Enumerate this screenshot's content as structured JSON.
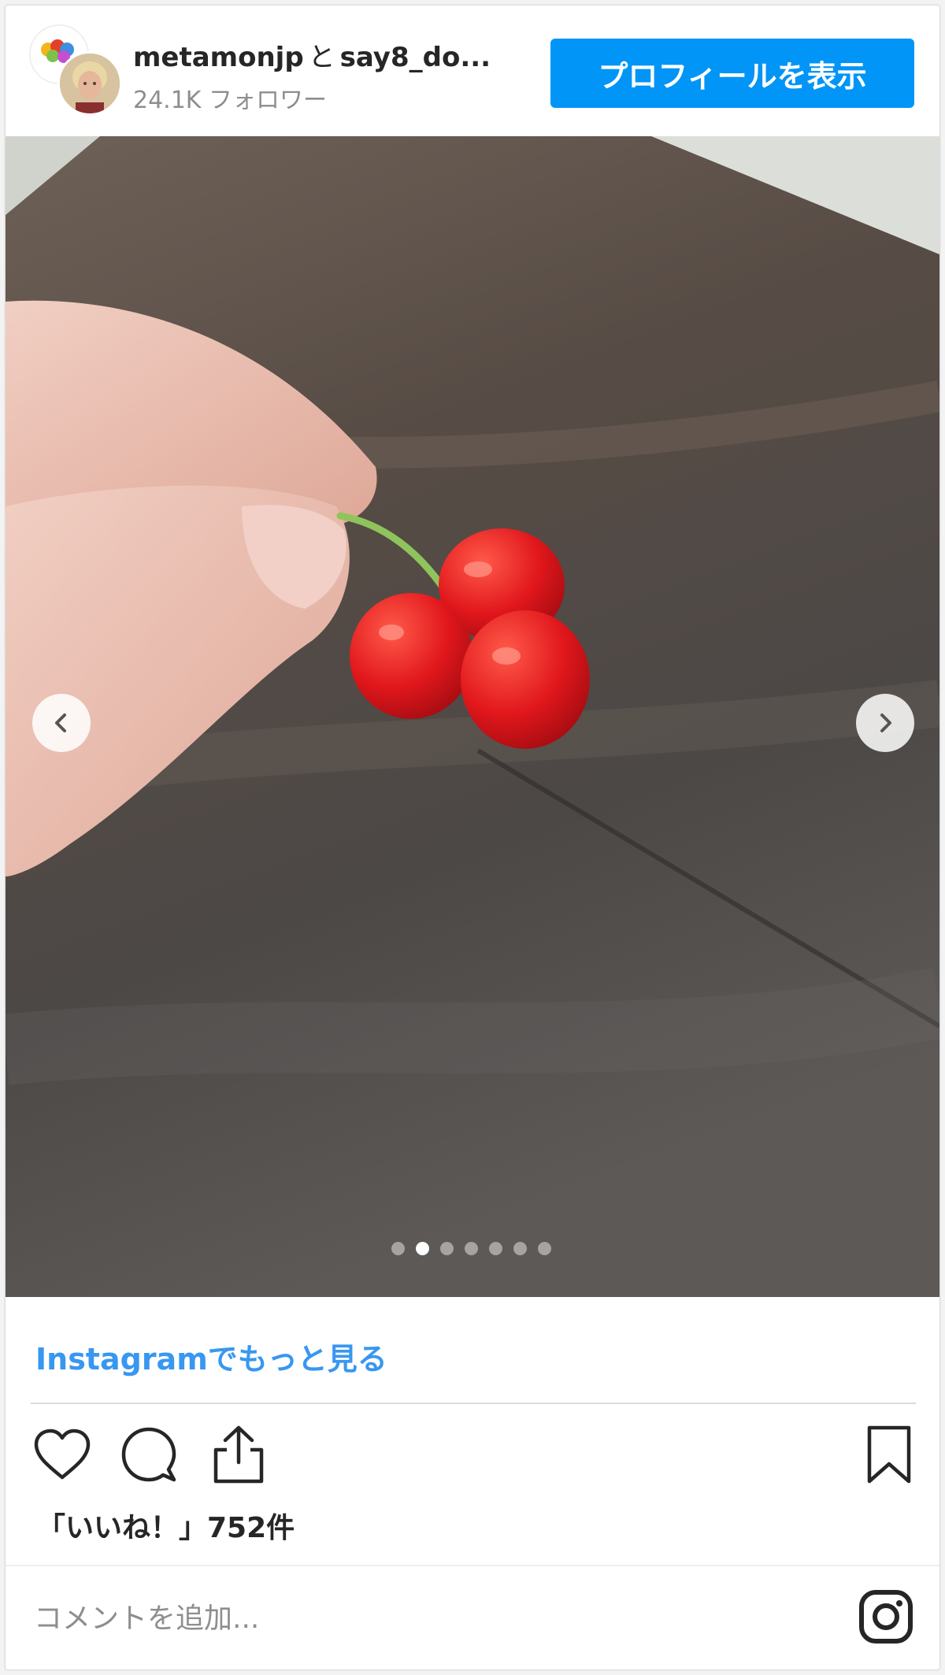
{
  "header": {
    "username_primary": "metamonjp",
    "conjunction": "と",
    "username_secondary": "say8_do...",
    "followers": "24.1K フォロワー",
    "profile_button": "プロフィールを表示"
  },
  "carousel": {
    "total_slides": 7,
    "active_index": 1
  },
  "more_link": "Instagramでもっと見る",
  "likes": "「いいね！」752件",
  "comment": {
    "placeholder": "コメントを追加..."
  },
  "colors": {
    "accent": "#0095f6",
    "link": "#3897f0",
    "text": "#262626",
    "muted": "#8e8e8e"
  },
  "icons": {
    "like": "heart-icon",
    "comment": "comment-icon",
    "share": "share-icon",
    "save": "bookmark-icon",
    "prev": "chevron-left-icon",
    "next": "chevron-right-icon",
    "brand": "instagram-icon"
  }
}
